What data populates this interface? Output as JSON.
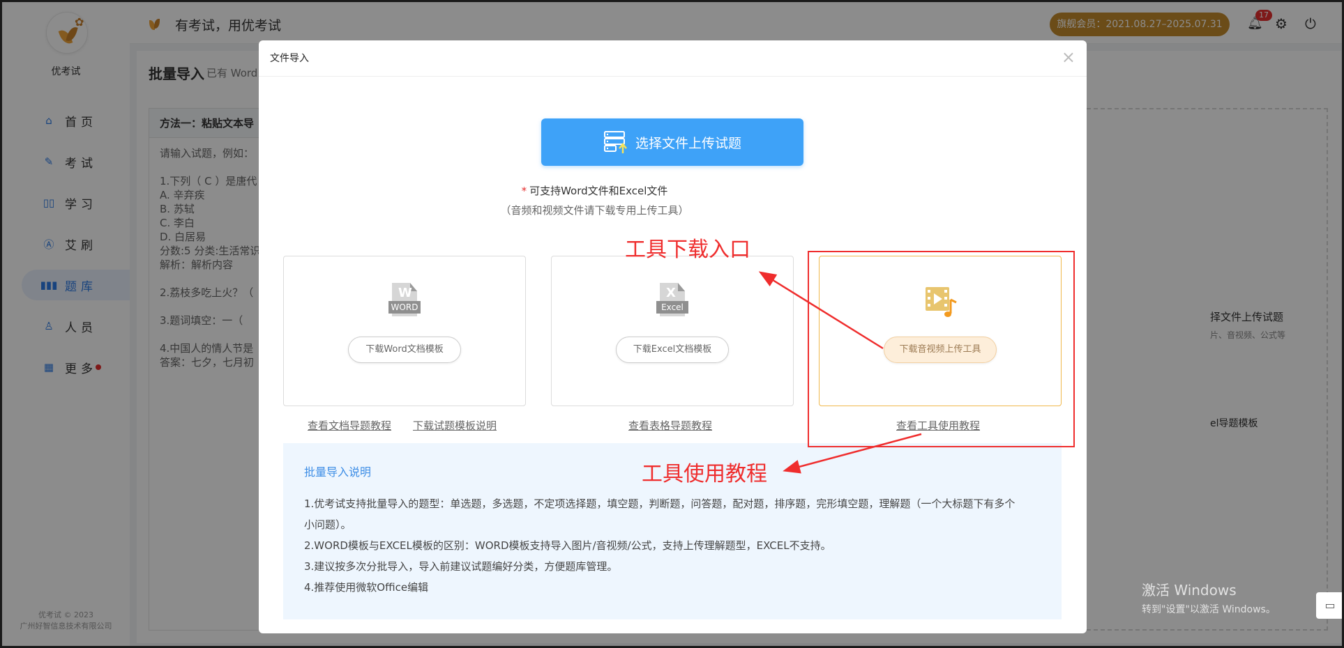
{
  "app": {
    "brand_name": "优考试",
    "slogan": "有考试，用优考试",
    "membership": "旗舰会员：2021.08.27–2025.07.31",
    "notification_count": "17",
    "copyright_line1": "优考试 © 2023",
    "copyright_line2": "广州好智信息技术有限公司"
  },
  "sidebar": {
    "items": [
      {
        "label": "首页",
        "icon": "home-icon"
      },
      {
        "label": "考试",
        "icon": "exam-icon"
      },
      {
        "label": "学习",
        "icon": "book-icon"
      },
      {
        "label": "艾刷",
        "icon": "brush-icon"
      },
      {
        "label": "题库",
        "icon": "question-bank-icon",
        "active": true
      },
      {
        "label": "人员",
        "icon": "person-icon"
      },
      {
        "label": "更多",
        "icon": "more-icon",
        "has_dot": true
      }
    ]
  },
  "page": {
    "title": "批量导入",
    "subtitle": "已有 Word",
    "paste_panel_title": "方法一：粘贴文本导",
    "paste_lines": [
      "请输入试题，例如：",
      "",
      "1.下列（ C ）是唐代",
      "A. 辛弃疾",
      "B. 苏轼",
      "C. 李白",
      "D. 白居易",
      "分数:5 分类:生活常识",
      "解析：解析内容",
      "",
      "2.荔枝多吃上火？（",
      "",
      "3.题词填空：一（",
      "",
      "4.中国人的情人节是",
      "答案：七夕，七月初"
    ],
    "right_panel": {
      "line1": "择文件上传试题",
      "line2": "片、音视频、公式等",
      "line3": "el导题模板"
    }
  },
  "watermark": {
    "line1": "激活 Windows",
    "line2": "转到\"设置\"以激活 Windows。"
  },
  "modal": {
    "title": "文件导入",
    "close": "×",
    "upload_button": "选择文件上传试题",
    "support_required_mark": "*",
    "support_text": "可支持Word文件和Excel文件",
    "support_sub": "（音频和视频文件请下载专用上传工具）",
    "cards": [
      {
        "icon_label": "WORD",
        "button": "下载Word文档模板"
      },
      {
        "icon_label": "Excel",
        "button": "下载Excel文档模板"
      },
      {
        "icon_label": "",
        "button": "下载音视频上传工具"
      }
    ],
    "links": {
      "doc_tutorial": "查看文档导题教程",
      "template_desc": "下载试题模板说明",
      "sheet_tutorial": "查看表格导题教程",
      "tool_tutorial": "查看工具使用教程"
    },
    "notes": {
      "title": "批量导入说明",
      "lines": [
        "1.优考试支持批量导入的题型：单选题，多选题，不定项选择题，填空题，判断题，问答题，配对题，排序题，完形填空题，理解题（一个大标题下有多个",
        "小问题）。",
        "2.WORD模板与EXCEL模板的区别：WORD模板支持导入图片/音视频/公式，支持上传理解题型，EXCEL不支持。",
        "3.建议按多次分批导入，导入前建议试题编好分类，方便题库管理。",
        "4.推荐使用微软Office编辑"
      ]
    }
  },
  "annotations": {
    "tool_download": "工具下载入口",
    "tool_tutorial": "工具使用教程",
    "color": "#ef2d2d"
  },
  "colors": {
    "primary": "#3ea2f8",
    "nav_active": "#2d7be5",
    "vip_gold": "#c48a2c",
    "alert_red": "#e52e2e"
  }
}
